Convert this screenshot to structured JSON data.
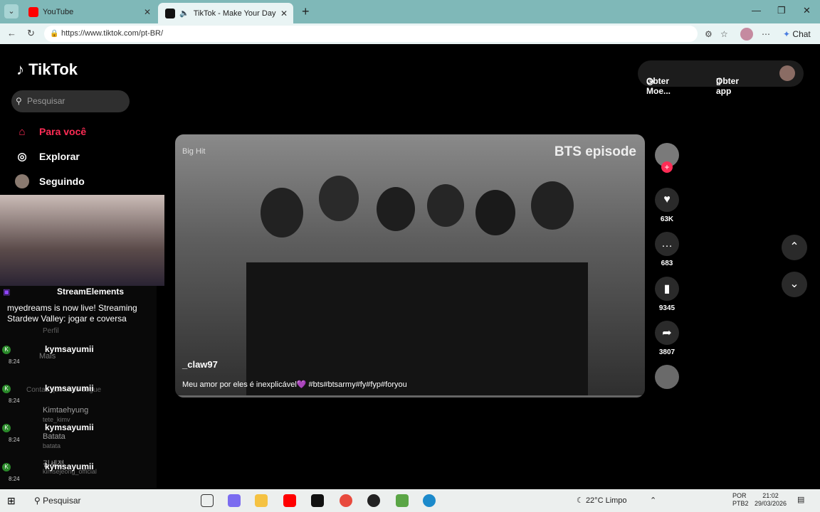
{
  "browser": {
    "tabs": [
      {
        "title": "YouTube",
        "color": "#ff0000"
      },
      {
        "title": "TikTok - Make Your Day",
        "color": "#111111"
      }
    ],
    "url": "https://www.tiktok.com/pt-BR/",
    "chat_label": "Chat"
  },
  "tiktok": {
    "logo": "TikTok",
    "search_placeholder": "Pesquisar",
    "nav": [
      {
        "label": "Para você",
        "icon": "home-icon"
      },
      {
        "label": "Explorar",
        "icon": "compass-icon"
      },
      {
        "label": "Seguindo",
        "icon": "avatar-icon"
      }
    ],
    "top_buttons": {
      "coins": "Obter Moe...",
      "app": "Obter app"
    },
    "video": {
      "title_overlay": "BTS episode",
      "small_overlay": "Big Hit",
      "username": "_claw97",
      "description": "Meu amor por eles é inexplicável💜 #bts#btsarmy#fy#fyp#foryou"
    },
    "actions": {
      "likes": "63K",
      "comments": "683",
      "saves": "9345",
      "shares": "3807"
    }
  },
  "overlay": {
    "header": "StreamElements",
    "message": "myedreams is now live! Streaming Stardew Valley: jogar e coversa",
    "chat": [
      {
        "name": "kymsayumii",
        "time": "8:24"
      },
      {
        "name": "kymsayumii",
        "time": "8:24"
      },
      {
        "name": "kymsayumii",
        "time": "8:24"
      },
      {
        "name": "kymsayumii",
        "time": "8:24"
      }
    ],
    "behind_text": [
      "Perfil",
      "Mais",
      "Contas que você segue",
      "Kimtaehyung",
      "tete_kimv",
      "Batata",
      "batata",
      "김세정",
      "kimsejeong_official"
    ]
  },
  "taskbar": {
    "search": "Pesquisar",
    "weather": "22°C  Limpo",
    "lang1": "POR",
    "lang2": "PTB2",
    "time": "21:02",
    "date": "29/03/2026"
  }
}
